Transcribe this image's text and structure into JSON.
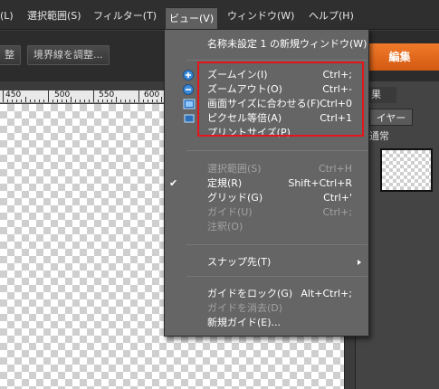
{
  "menubar": {
    "items": [
      {
        "label": "(L)"
      },
      {
        "label": "選択範囲(S)"
      },
      {
        "label": "フィルター(T)"
      },
      {
        "label": "ビュー(V)"
      },
      {
        "label": "ウィンドウ(W)"
      },
      {
        "label": "ヘルプ(H)"
      }
    ]
  },
  "options": {
    "left_label": "整",
    "adjust_border_button": "境界線を調整..."
  },
  "edit_tab": "編集",
  "ruler": {
    "marks": [
      "450",
      "500",
      "550",
      "600"
    ]
  },
  "panels": {
    "effects_tab": "果",
    "layers_tab": "イヤー",
    "blend_mode": "通常"
  },
  "view_menu": {
    "new_window": "名称未設定 1 の新規ウィンドウ(W)",
    "zoom_in": {
      "label": "ズームイン(I)",
      "shortcut": "Ctrl+;"
    },
    "zoom_out": {
      "label": "ズームアウト(O)",
      "shortcut": "Ctrl+-"
    },
    "fit_screen": {
      "label": "画面サイズに合わせる(F)",
      "shortcut": "Ctrl+0"
    },
    "actual_pixels": {
      "label": "ピクセル等倍(A)",
      "shortcut": "Ctrl+1"
    },
    "print_size": {
      "label": "プリントサイズ(P)"
    },
    "selection": {
      "label": "選択範囲(S)",
      "shortcut": "Ctrl+H"
    },
    "rulers": {
      "label": "定規(R)",
      "shortcut": "Shift+Ctrl+R"
    },
    "grid": {
      "label": "グリッド(G)",
      "shortcut": "Ctrl+'"
    },
    "guides": {
      "label": "ガイド(U)",
      "shortcut": "Ctrl+;"
    },
    "annotations": {
      "label": "注釈(O)"
    },
    "snap_to": {
      "label": "スナップ先(T)"
    },
    "lock_guides": {
      "label": "ガイドをロック(G)",
      "shortcut": "Alt+Ctrl+;"
    },
    "clear_guides": {
      "label": "ガイドを消去(D)"
    },
    "new_guide": {
      "label": "新規ガイド(E)..."
    }
  },
  "colors": {
    "highlight": "#e5151c",
    "accent": "#e8681d"
  }
}
